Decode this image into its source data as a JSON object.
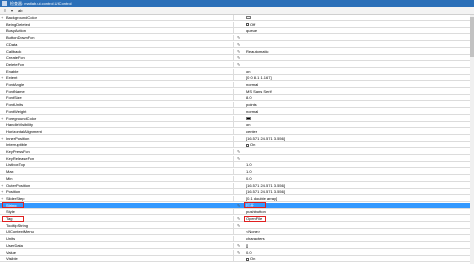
{
  "window": {
    "title": "检查器: matlab.ui.control.UIControl"
  },
  "toolbar": {
    "label": "ab",
    "sort_icon": "sort-icon",
    "filter_icon": "filter-icon"
  },
  "properties": [
    {
      "name": "BackgroundColor",
      "value": "",
      "kind": "color",
      "color": "#f0f0f0",
      "expander": "+",
      "edit": false
    },
    {
      "name": "BeingDeleted",
      "value": "Off",
      "kind": "check",
      "expander": "",
      "edit": false
    },
    {
      "name": "BusyAction",
      "value": "queue",
      "expander": "",
      "edit": false
    },
    {
      "name": "ButtonDownFcn",
      "value": "",
      "expander": "",
      "edit": true
    },
    {
      "name": "CData",
      "value": "",
      "expander": "",
      "edit": true
    },
    {
      "name": "Callback",
      "value": "Reautomatic",
      "expander": "",
      "edit": true
    },
    {
      "name": "CreateFcn",
      "value": "",
      "expander": "",
      "edit": true
    },
    {
      "name": "DeleteFcn",
      "value": "",
      "expander": "",
      "edit": true
    },
    {
      "name": "Enable",
      "value": "on",
      "expander": "",
      "edit": false
    },
    {
      "name": "Extent",
      "value": "[0 0 8.1 1.167]",
      "expander": "+",
      "edit": false
    },
    {
      "name": "FontAngle",
      "value": "normal",
      "expander": "",
      "edit": false
    },
    {
      "name": "FontName",
      "value": "MS Sans Serif",
      "expander": "",
      "edit": false
    },
    {
      "name": "FontSize",
      "value": "8.0",
      "expander": "",
      "edit": false
    },
    {
      "name": "FontUnits",
      "value": "points",
      "expander": "",
      "edit": false
    },
    {
      "name": "FontWeight",
      "value": "normal",
      "expander": "",
      "edit": false
    },
    {
      "name": "ForegroundColor",
      "value": "",
      "kind": "color",
      "color": "#000000",
      "expander": "+",
      "edit": false
    },
    {
      "name": "HandleVisibility",
      "value": "on",
      "expander": "",
      "edit": false
    },
    {
      "name": "HorizontalAlignment",
      "value": "center",
      "expander": "",
      "edit": false
    },
    {
      "name": "InnerPosition",
      "value": "[16.571 24.571 3.556]",
      "expander": "+",
      "edit": false
    },
    {
      "name": "Interruptible",
      "value": "On",
      "kind": "check",
      "expander": "",
      "edit": false
    },
    {
      "name": "KeyPressFcn",
      "value": "",
      "expander": "",
      "edit": true
    },
    {
      "name": "KeyReleaseFcn",
      "value": "",
      "expander": "",
      "edit": true
    },
    {
      "name": "ListboxTop",
      "value": "1.0",
      "expander": "",
      "edit": false
    },
    {
      "name": "Max",
      "value": "1.0",
      "expander": "",
      "edit": false
    },
    {
      "name": "Min",
      "value": "0.0",
      "expander": "",
      "edit": false
    },
    {
      "name": "OuterPosition",
      "value": "[16.571 24.571 3.556]",
      "expander": "+",
      "edit": false
    },
    {
      "name": "Position",
      "value": "[16.571 24.571 3.556]",
      "expander": "+",
      "edit": false
    },
    {
      "name": "SliderStep",
      "value": "[0.1 double array]",
      "expander": "+",
      "edit": false
    },
    {
      "name": "String",
      "value": "打开",
      "expander": "",
      "edit": true,
      "selected": true
    },
    {
      "name": "Style",
      "value": "pushbutton",
      "expander": "",
      "edit": false
    },
    {
      "name": "Tag",
      "value": "OpenFile",
      "expander": "",
      "edit": true
    },
    {
      "name": "TooltipString",
      "value": "",
      "expander": "",
      "edit": true
    },
    {
      "name": "UIContextMenu",
      "value": "<None>",
      "expander": "",
      "edit": false
    },
    {
      "name": "Units",
      "value": "characters",
      "expander": "",
      "edit": false
    },
    {
      "name": "UserData",
      "value": "[]",
      "expander": "",
      "edit": true
    },
    {
      "name": "Value",
      "value": "0.0",
      "expander": "",
      "edit": true
    },
    {
      "name": "Visible",
      "value": "On",
      "kind": "check",
      "expander": "",
      "edit": false
    }
  ],
  "colors": {
    "selection": "#3399ff",
    "highlight": "#e02020",
    "titlebar": "#2b6fb8"
  }
}
